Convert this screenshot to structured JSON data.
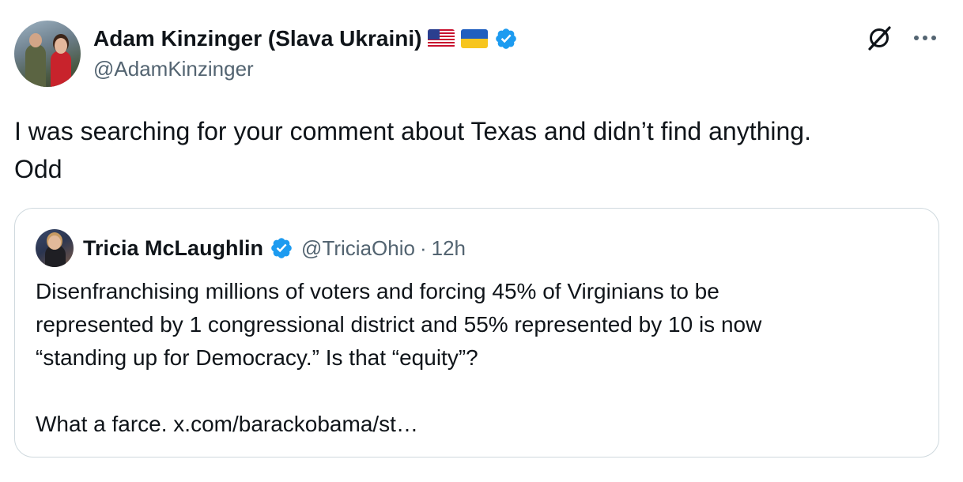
{
  "author": {
    "display_name": "Adam Kinzinger (Slava Ukraini)",
    "handle": "@AdamKinzinger",
    "flags": [
      "us-flag-icon",
      "ukraine-flag-icon"
    ],
    "verified": true
  },
  "tweet": {
    "lines": [
      "I was searching for your comment about Texas and didn’t find anything.",
      "Odd"
    ]
  },
  "quoted_tweet": {
    "display_name": "Tricia McLaughlin",
    "handle": "@TriciaOhio",
    "separator": "·",
    "time": "12h",
    "verified": true,
    "lines": [
      "Disenfranchising millions of voters and forcing 45% of Virginians to be",
      "represented by 1 congressional district and 55% represented by 10 is now",
      "“standing up for Democracy.” Is that “equity”?",
      "",
      "What a farce. x.com/barackobama/st…"
    ]
  },
  "icons": {
    "grok": "grok-icon",
    "more": "more-options-icon",
    "verified": "verified-badge-icon"
  },
  "colors": {
    "verified_blue": "#1d9bf0",
    "text_primary": "#0f1419",
    "text_secondary": "#536471",
    "border": "#cfd9de"
  }
}
